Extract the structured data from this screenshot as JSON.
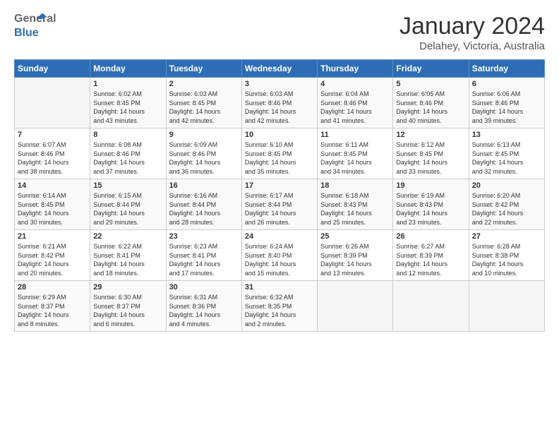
{
  "header": {
    "logo_general": "General",
    "logo_blue": "Blue",
    "month_year": "January 2024",
    "location": "Delahey, Victoria, Australia"
  },
  "days_of_week": [
    "Sunday",
    "Monday",
    "Tuesday",
    "Wednesday",
    "Thursday",
    "Friday",
    "Saturday"
  ],
  "weeks": [
    [
      {
        "num": "",
        "empty": true
      },
      {
        "num": "1",
        "sunrise": "6:02 AM",
        "sunset": "8:45 PM",
        "daylight": "14 hours and 43 minutes."
      },
      {
        "num": "2",
        "sunrise": "6:03 AM",
        "sunset": "8:45 PM",
        "daylight": "14 hours and 42 minutes."
      },
      {
        "num": "3",
        "sunrise": "6:03 AM",
        "sunset": "8:46 PM",
        "daylight": "14 hours and 42 minutes."
      },
      {
        "num": "4",
        "sunrise": "6:04 AM",
        "sunset": "8:46 PM",
        "daylight": "14 hours and 41 minutes."
      },
      {
        "num": "5",
        "sunrise": "6:05 AM",
        "sunset": "8:46 PM",
        "daylight": "14 hours and 40 minutes."
      },
      {
        "num": "6",
        "sunrise": "6:06 AM",
        "sunset": "8:46 PM",
        "daylight": "14 hours and 39 minutes."
      }
    ],
    [
      {
        "num": "7",
        "sunrise": "6:07 AM",
        "sunset": "8:46 PM",
        "daylight": "14 hours and 38 minutes."
      },
      {
        "num": "8",
        "sunrise": "6:08 AM",
        "sunset": "8:46 PM",
        "daylight": "14 hours and 37 minutes."
      },
      {
        "num": "9",
        "sunrise": "6:09 AM",
        "sunset": "8:46 PM",
        "daylight": "14 hours and 36 minutes."
      },
      {
        "num": "10",
        "sunrise": "6:10 AM",
        "sunset": "8:45 PM",
        "daylight": "14 hours and 35 minutes."
      },
      {
        "num": "11",
        "sunrise": "6:11 AM",
        "sunset": "8:45 PM",
        "daylight": "14 hours and 34 minutes."
      },
      {
        "num": "12",
        "sunrise": "6:12 AM",
        "sunset": "8:45 PM",
        "daylight": "14 hours and 33 minutes."
      },
      {
        "num": "13",
        "sunrise": "6:13 AM",
        "sunset": "8:45 PM",
        "daylight": "14 hours and 32 minutes."
      }
    ],
    [
      {
        "num": "14",
        "sunrise": "6:14 AM",
        "sunset": "8:45 PM",
        "daylight": "14 hours and 30 minutes."
      },
      {
        "num": "15",
        "sunrise": "6:15 AM",
        "sunset": "8:44 PM",
        "daylight": "14 hours and 29 minutes."
      },
      {
        "num": "16",
        "sunrise": "6:16 AM",
        "sunset": "8:44 PM",
        "daylight": "14 hours and 28 minutes."
      },
      {
        "num": "17",
        "sunrise": "6:17 AM",
        "sunset": "8:44 PM",
        "daylight": "14 hours and 26 minutes."
      },
      {
        "num": "18",
        "sunrise": "6:18 AM",
        "sunset": "8:43 PM",
        "daylight": "14 hours and 25 minutes."
      },
      {
        "num": "19",
        "sunrise": "6:19 AM",
        "sunset": "8:43 PM",
        "daylight": "14 hours and 23 minutes."
      },
      {
        "num": "20",
        "sunrise": "6:20 AM",
        "sunset": "8:42 PM",
        "daylight": "14 hours and 22 minutes."
      }
    ],
    [
      {
        "num": "21",
        "sunrise": "6:21 AM",
        "sunset": "8:42 PM",
        "daylight": "14 hours and 20 minutes."
      },
      {
        "num": "22",
        "sunrise": "6:22 AM",
        "sunset": "8:41 PM",
        "daylight": "14 hours and 18 minutes."
      },
      {
        "num": "23",
        "sunrise": "6:23 AM",
        "sunset": "8:41 PM",
        "daylight": "14 hours and 17 minutes."
      },
      {
        "num": "24",
        "sunrise": "6:24 AM",
        "sunset": "8:40 PM",
        "daylight": "14 hours and 15 minutes."
      },
      {
        "num": "25",
        "sunrise": "6:26 AM",
        "sunset": "8:39 PM",
        "daylight": "14 hours and 13 minutes."
      },
      {
        "num": "26",
        "sunrise": "6:27 AM",
        "sunset": "8:39 PM",
        "daylight": "14 hours and 12 minutes."
      },
      {
        "num": "27",
        "sunrise": "6:28 AM",
        "sunset": "8:38 PM",
        "daylight": "14 hours and 10 minutes."
      }
    ],
    [
      {
        "num": "28",
        "sunrise": "6:29 AM",
        "sunset": "8:37 PM",
        "daylight": "14 hours and 8 minutes."
      },
      {
        "num": "29",
        "sunrise": "6:30 AM",
        "sunset": "8:37 PM",
        "daylight": "14 hours and 6 minutes."
      },
      {
        "num": "30",
        "sunrise": "6:31 AM",
        "sunset": "8:36 PM",
        "daylight": "14 hours and 4 minutes."
      },
      {
        "num": "31",
        "sunrise": "6:32 AM",
        "sunset": "8:35 PM",
        "daylight": "14 hours and 2 minutes."
      },
      {
        "num": "",
        "empty": true
      },
      {
        "num": "",
        "empty": true
      },
      {
        "num": "",
        "empty": true
      }
    ]
  ]
}
